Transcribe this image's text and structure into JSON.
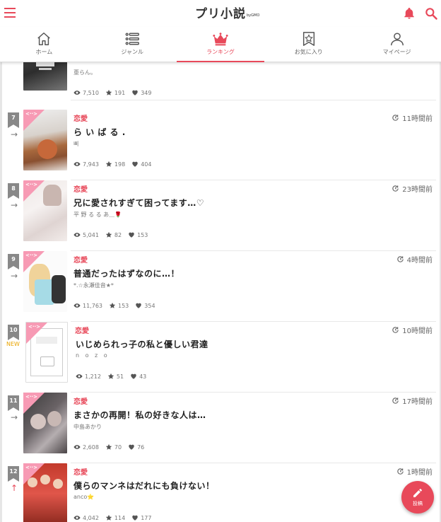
{
  "app": {
    "logo_main": "プリ小説",
    "logo_sub": "byGMO"
  },
  "header": {
    "menu_icon": "menu-icon",
    "bell_icon": "bell-icon",
    "search_icon": "search-icon",
    "accent": "#e8495a"
  },
  "tabs": [
    {
      "label": "ホーム",
      "icon": "home-icon"
    },
    {
      "label": "ジャンル",
      "icon": "genre-list-icon"
    },
    {
      "label": "ランキング",
      "icon": "crown-icon",
      "active": true
    },
    {
      "label": "お気に入り",
      "icon": "favorite-star-icon"
    },
    {
      "label": "マイページ",
      "icon": "user-icon"
    }
  ],
  "rows": [
    {
      "rank": "",
      "trend": "right",
      "genre": "",
      "time": "",
      "title": "",
      "author": "亜らん。",
      "views": "7,510",
      "stars": "191",
      "hearts": "349"
    },
    {
      "rank": "7",
      "trend": "right",
      "genre": "恋愛",
      "time": "11時間前",
      "title": "ら い ば る .",
      "author": "삐",
      "views": "7,943",
      "stars": "198",
      "hearts": "404"
    },
    {
      "rank": "8",
      "trend": "right",
      "genre": "恋愛",
      "time": "23時間前",
      "title": "兄に愛されすぎて困ってます…♡",
      "author": "平 野 る る あ＿🌹",
      "views": "5,041",
      "stars": "82",
      "hearts": "153"
    },
    {
      "rank": "9",
      "trend": "right",
      "genre": "恋愛",
      "time": "4時間前",
      "title": "普通だったはずなのに…！",
      "author": "*.☆永瀬佳音★*",
      "views": "11,763",
      "stars": "153",
      "hearts": "354"
    },
    {
      "rank": "10",
      "trend": "NEW",
      "genre": "恋愛",
      "time": "10時間前",
      "title": "いじめられっ子の私と優しい君達",
      "author": "n o z o",
      "views": "1,212",
      "stars": "51",
      "hearts": "43"
    },
    {
      "rank": "11",
      "trend": "right",
      "genre": "恋愛",
      "time": "17時間前",
      "title": "まさかの再開！私の好きな人は…",
      "author": "中島あかり",
      "views": "2,608",
      "stars": "70",
      "hearts": "76"
    },
    {
      "rank": "12",
      "trend": "up",
      "genre": "恋愛",
      "time": "1時間前",
      "title": "僕らのマンネはだれにも負けない！",
      "author": "anco⭐",
      "views": "4,042",
      "stars": "114",
      "hearts": "177"
    }
  ],
  "fab": {
    "label": "投稿",
    "icon": "pencil-icon"
  },
  "colors": {
    "accent": "#e8495a",
    "corner_pink": "#f79ab4",
    "new_label": "#e9a400",
    "rank_badge": "#888888"
  }
}
